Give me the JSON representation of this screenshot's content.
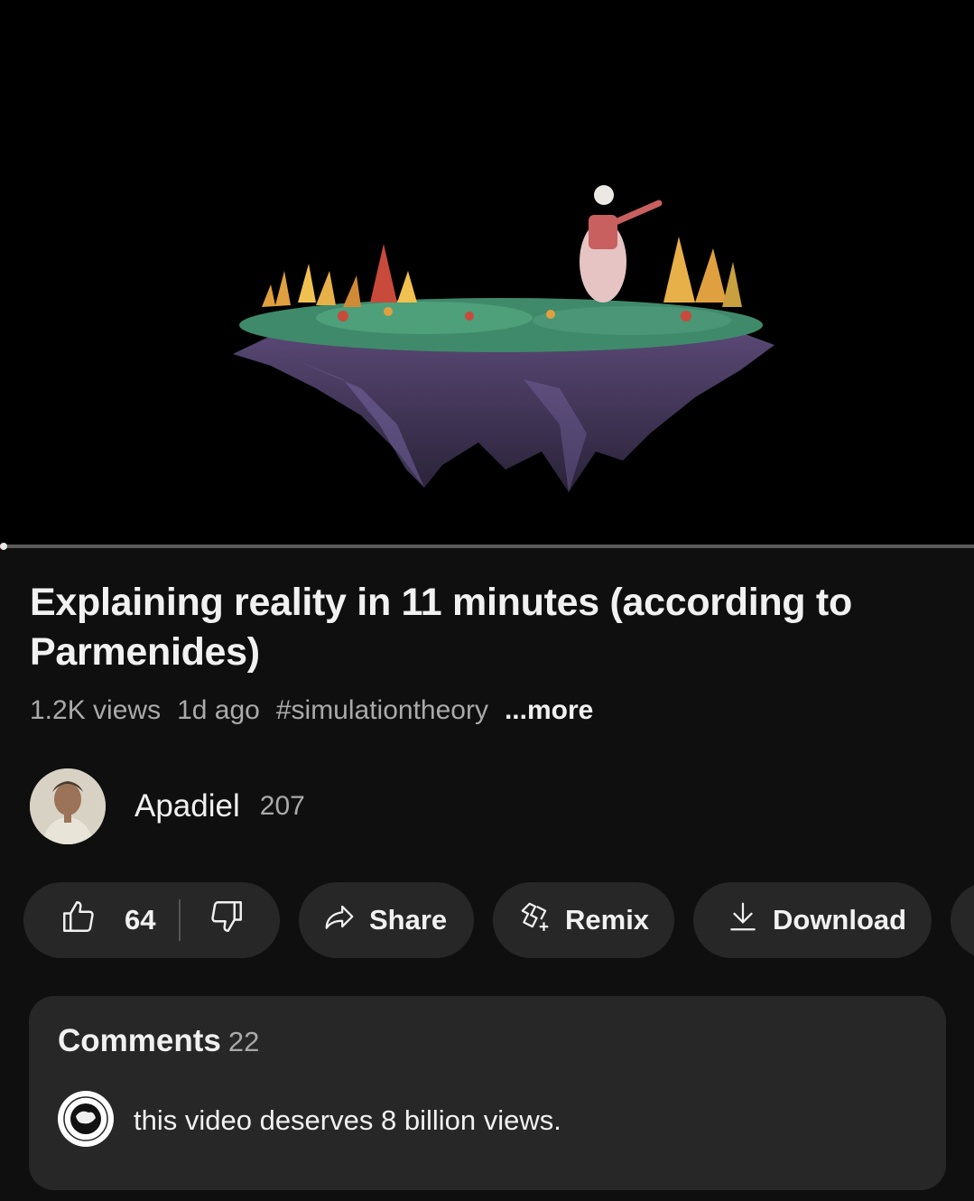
{
  "video": {
    "title": "Explaining reality in 11 minutes (according to Parmenides)",
    "progress_percent": 0.5
  },
  "meta": {
    "views": "1.2K views",
    "age": "1d ago",
    "hashtag": "#simulationtheory",
    "more_label": "...more"
  },
  "channel": {
    "name": "Apadiel",
    "subscribers": "207"
  },
  "actions": {
    "like_count": "64",
    "share_label": "Share",
    "remix_label": "Remix",
    "download_label": "Download"
  },
  "comments": {
    "header": "Comments",
    "count": "22",
    "top_comment": "this video deserves 8 billion views."
  },
  "icons": {
    "like": "thumbs-up-icon",
    "dislike": "thumbs-down-icon",
    "share": "share-arrow-icon",
    "remix": "remix-icon",
    "download": "download-icon"
  },
  "colors": {
    "background": "#0f0f0f",
    "pill": "#272727",
    "secondary_text": "#aaaaaa",
    "primary_text": "#f1f1f1"
  }
}
